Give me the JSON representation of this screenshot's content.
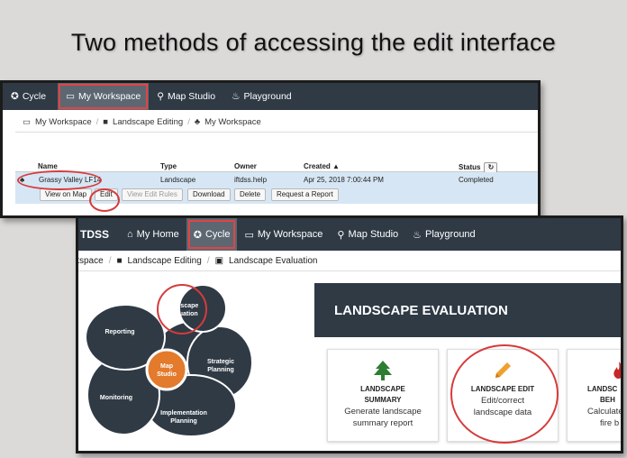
{
  "slide_title": "Two methods of accessing the edit interface",
  "panel1": {
    "nav": [
      {
        "label": "Cycle",
        "icon": "cycle-icon"
      },
      {
        "label": "My Workspace",
        "icon": "window-icon",
        "active": true
      },
      {
        "label": "Map Studio",
        "icon": "map-marker-icon"
      },
      {
        "label": "Playground",
        "icon": "flame-icon"
      }
    ],
    "breadcrumbs": [
      "My Workspace",
      "Landscape Editing",
      "My Workspace"
    ],
    "table": {
      "headers": {
        "name": "Name",
        "type": "Type",
        "owner": "Owner",
        "created": "Created",
        "status": "Status"
      },
      "row": {
        "name": "Grassy Valley LF14",
        "type": "Landscape",
        "owner": "iftdss.help",
        "created": "Apr 25, 2018 7:00:44 PM",
        "status": "Completed"
      },
      "actions": [
        "View on Map",
        "Edit",
        "View Edit Rules",
        "Download",
        "Delete",
        "Request a Report"
      ]
    }
  },
  "panel2": {
    "brand": "TDSS",
    "nav": [
      {
        "label": "My Home",
        "icon": "home-icon"
      },
      {
        "label": "Cycle",
        "icon": "cycle-icon",
        "active": true
      },
      {
        "label": "My Workspace",
        "icon": "window-icon"
      },
      {
        "label": "Map Studio",
        "icon": "map-marker-icon"
      },
      {
        "label": "Playground",
        "icon": "flame-icon"
      }
    ],
    "breadcrumbs": [
      "kspace",
      "Landscape Editing",
      "Landscape Evaluation"
    ],
    "cycle_labels": {
      "landscape_evaluation_1": "Landscape",
      "landscape_evaluation_2": "Evaluation",
      "reporting": "Reporting",
      "map_studio_1": "Map",
      "map_studio_2": "Studio",
      "strategic_1": "Strategic",
      "strategic_2": "Planning",
      "monitoring": "Monitoring",
      "implementation_1": "Implementation",
      "implementation_2": "Planning"
    },
    "banner": "LANDSCAPE EVALUATION",
    "cards": [
      {
        "title_1": "LANDSCAPE",
        "title_2": "SUMMARY",
        "desc_1": "Generate landscape",
        "desc_2": "summary report",
        "icon": "tree-icon"
      },
      {
        "title_1": "LANDSCAPE EDIT",
        "title_2": "",
        "desc_1": "Edit/correct",
        "desc_2": "landscape data",
        "icon": "pencil-icon"
      },
      {
        "title_1": "LANDSC",
        "title_2": "BEH",
        "desc_1": "Calculate",
        "desc_2": "fire b",
        "icon": "flame-icon"
      }
    ]
  },
  "colors": {
    "nav_bg": "#2f3a45",
    "nav_active": "#5c6772",
    "highlight_red": "#d63b3b",
    "cycle_dark": "#2f3a45",
    "map_studio_orange": "#e37a2c",
    "selected_row": "#d6e6f4",
    "tree_green": "#2e7d32",
    "pencil_orange": "#f0a030"
  }
}
